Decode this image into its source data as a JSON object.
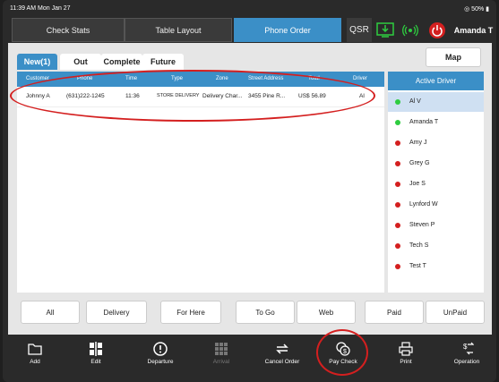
{
  "status": {
    "time_date": "11:39 AM  Mon Jan 27",
    "battery": "50%"
  },
  "topnav": {
    "tabs": [
      "Check Stats",
      "Table Layout",
      "Phone Order"
    ],
    "active_tab": "Phone Order",
    "qsr": "QSR",
    "user": "Amanda T"
  },
  "subtabs": [
    "New(1)",
    "Out",
    "Complete",
    "Future"
  ],
  "map_label": "Map",
  "table": {
    "headers": [
      "Customer",
      "Phone",
      "Time",
      "Type",
      "Zone",
      "Street Address",
      "Total",
      "Driver"
    ],
    "rows": [
      {
        "customer": "Johnny A",
        "phone": "(631)222-1245",
        "time": "11:36",
        "type": "STORE DELIVERY",
        "zone": "Delivery Char...",
        "address": "3455  Pine R...",
        "total": "US$ 56.89",
        "driver": "Al"
      }
    ]
  },
  "drivers": {
    "header": "Active Driver",
    "list": [
      {
        "name": "Al V",
        "status": "active",
        "color": "#2ecc40"
      },
      {
        "name": "Amanda T",
        "status": "active",
        "color": "#2ecc40"
      },
      {
        "name": "Amy J",
        "status": "inactive",
        "color": "#d41f1f"
      },
      {
        "name": "Grey G",
        "status": "inactive",
        "color": "#d41f1f"
      },
      {
        "name": "Joe S",
        "status": "inactive",
        "color": "#d41f1f"
      },
      {
        "name": "Lynford W",
        "status": "inactive",
        "color": "#d41f1f"
      },
      {
        "name": "Steven P",
        "status": "inactive",
        "color": "#d41f1f"
      },
      {
        "name": "Tech S",
        "status": "inactive",
        "color": "#d41f1f"
      },
      {
        "name": "Test T",
        "status": "inactive",
        "color": "#d41f1f"
      }
    ]
  },
  "filters": [
    "All",
    "Delivery",
    "For Here",
    "To Go",
    "Web",
    "Paid",
    "UnPaid"
  ],
  "toolbar": [
    "Add",
    "Edit",
    "Departure",
    "Arrival",
    "Cancel Order",
    "Pay Check",
    "Print",
    "Operation"
  ],
  "colors": {
    "accent": "#3b8fc7",
    "highlight": "#d41f1f",
    "active_dot": "#2ecc40"
  }
}
